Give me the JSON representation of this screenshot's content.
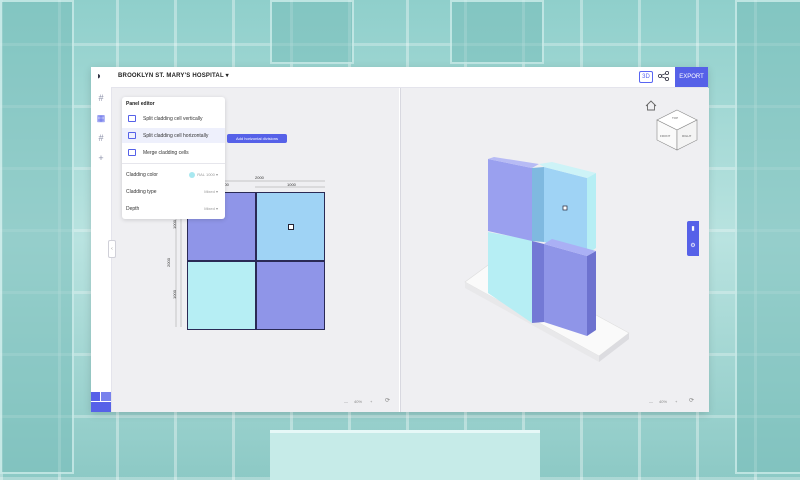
{
  "window": {
    "project_name": "BROOKLYN ST. MARY'S HOSPITAL",
    "project_caret": "▾",
    "export_label": "EXPORT",
    "view_toggle_label": "3D"
  },
  "rail": {
    "items": [
      {
        "icon": "grid-icon",
        "glyph": "#",
        "active": false
      },
      {
        "icon": "panels-icon",
        "glyph": "▦",
        "active": true
      },
      {
        "icon": "grid-alt-icon",
        "glyph": "#",
        "active": false
      },
      {
        "icon": "add-icon",
        "glyph": "+",
        "active": false
      }
    ]
  },
  "panel": {
    "title": "Panel editor",
    "items": [
      {
        "label": "Split cladding cell vertically"
      },
      {
        "label": "Split cladding cell horizontally"
      },
      {
        "label": "Merge cladding cells"
      }
    ],
    "tooltip": "Add horizontal divisions",
    "rows": [
      {
        "label": "Cladding color",
        "value": "RAL 1000"
      },
      {
        "label": "Cladding type",
        "value": "Mixed"
      },
      {
        "label": "Depth",
        "value": "Mixed"
      }
    ]
  },
  "dimensions": {
    "top_total": "2000",
    "top_left": "1000",
    "top_right": "1000",
    "left_total": "2000",
    "left_top": "1000",
    "left_bottom": "1000"
  },
  "zoom_left": {
    "minus": "—",
    "value": "40%",
    "plus": "+",
    "fit": "⟳"
  },
  "zoom_right": {
    "minus": "—",
    "value": "40%",
    "plus": "+",
    "fit": "⟳"
  },
  "view_cube": {
    "top": "TOP",
    "front": "FRONT",
    "right": "RIGHT"
  },
  "colors": {
    "accent": "#5661e8",
    "cell_purple": "#8f95e8",
    "cell_cyan_light": "#b6eef4",
    "cell_blue": "#9fd3f5"
  }
}
